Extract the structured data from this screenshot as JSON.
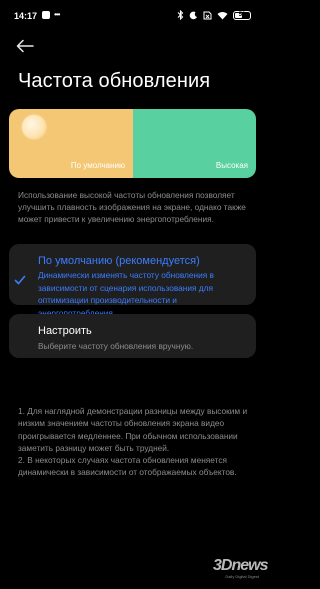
{
  "status_bar": {
    "time": "14:17",
    "dots": "•••",
    "battery": "50",
    "battery_level": 0.5
  },
  "page": {
    "title": "Частота обновления"
  },
  "preview": {
    "default_label": "По умолчанию",
    "high_label": "Высокая",
    "colors": {
      "default": "#f4c775",
      "high": "#58d0a0"
    }
  },
  "description": "Использование высокой частоты обновления позволяет улучшить плавность изображения на экране, однако также может привести к увеличению энергопотребления.",
  "options": {
    "default": {
      "title": "По умолчанию (рекомендуется)",
      "subtitle": "Динамически изменять частоту обновления в зависимости от сценария использования для оптимизации производительности и энергопотребления.",
      "selected": true
    },
    "custom": {
      "title": "Настроить",
      "subtitle": "Выберите частоту обновления вручную."
    }
  },
  "notes": {
    "note1": "1. Для наглядной демонстрации разницы между высоким и низким значением частоты обновления экрана видео проигрывается медленнее. При обычном использовании заметить разницу может быть трудней.",
    "note2": "2. В некоторых случаях частота обновления меняется динамически в зависимости от отображаемых объектов."
  },
  "watermark": {
    "logo": "3Dnews",
    "tagline": "Daily Digital Digest"
  },
  "colors": {
    "accent": "#3c7dff",
    "background": "#000000",
    "card": "#1f1f1f",
    "secondary_text": "#8d8d8d"
  }
}
